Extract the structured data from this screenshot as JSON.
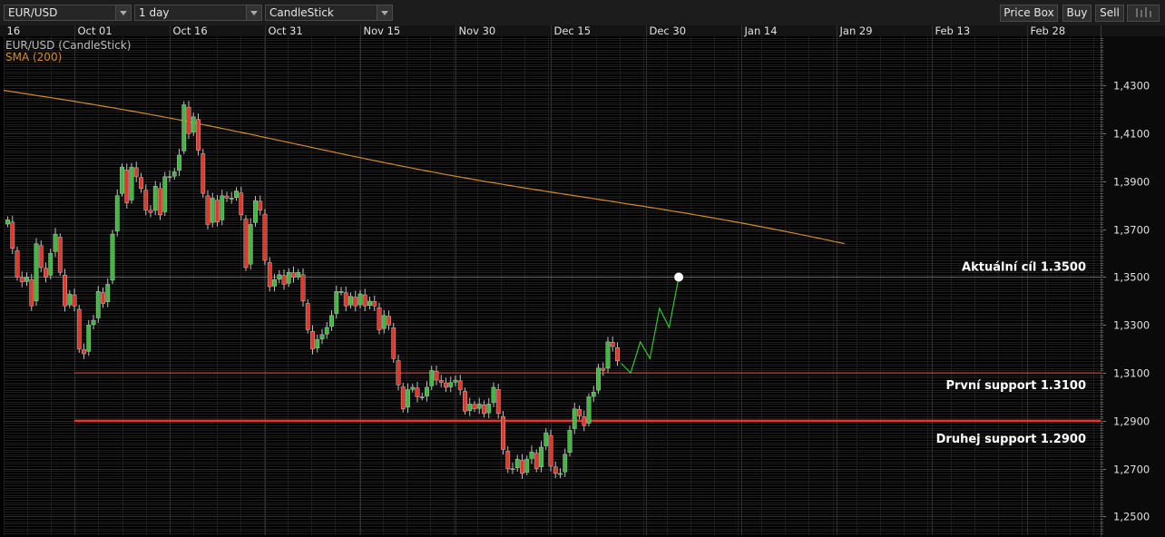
{
  "toolbar": {
    "symbol": "EUR/USD",
    "interval": "1 day",
    "chart_type": "CandleStick",
    "price_box_label": "Price Box",
    "buy_label": "Buy",
    "sell_label": "Sell",
    "settings_icon": "chart-settings-icon"
  },
  "colors": {
    "background": "#000000",
    "grid": "#1e1e1e",
    "bull": "#3fb93f",
    "bear": "#e0392b",
    "sma": "#d48a2a",
    "target_line": "#2f8f2f",
    "support_line": "#e0392b",
    "projection": "#2fc62f"
  },
  "chart_data": {
    "type": "candlestick",
    "legend": [
      "EUR/USD (CandleStick)",
      "SMA (200)"
    ],
    "x_ticks": [
      "16",
      "Oct 01",
      "Oct 16",
      "Oct 31",
      "Nov 15",
      "Nov 30",
      "Dec 15",
      "Dec 30",
      "Jan 14",
      "Jan 29",
      "Feb 13",
      "Feb 28"
    ],
    "y_ticks": [
      "1,4300",
      "1,4100",
      "1,3900",
      "1,3700",
      "1,3500",
      "1,3300",
      "1,3100",
      "1,2900",
      "1,2700",
      "1,2500"
    ],
    "ylim": [
      1.2422,
      1.4506
    ],
    "candles_close": [
      1.374,
      1.362,
      1.35,
      1.348,
      1.35,
      1.338,
      1.364,
      1.354,
      1.35,
      1.36,
      1.368,
      1.352,
      1.338,
      1.343,
      1.338,
      1.32,
      1.318,
      1.33,
      1.332,
      1.344,
      1.339,
      1.347,
      1.368,
      1.384,
      1.396,
      1.381,
      1.396,
      1.392,
      1.387,
      1.378,
      1.377,
      1.388,
      1.376,
      1.392,
      1.392,
      1.394,
      1.401,
      1.422,
      1.41,
      1.417,
      1.403,
      1.385,
      1.372,
      1.383,
      1.373,
      1.384,
      1.383,
      1.383,
      1.386,
      1.376,
      1.354,
      1.372,
      1.382,
      1.378,
      1.357,
      1.346,
      1.349,
      1.351,
      1.347,
      1.352,
      1.35,
      1.352,
      1.34,
      1.328,
      1.32,
      1.324,
      1.326,
      1.329,
      1.334,
      1.344,
      1.344,
      1.338,
      1.342,
      1.338,
      1.343,
      1.338,
      1.34,
      1.338,
      1.328,
      1.334,
      1.33,
      1.316,
      1.305,
      1.295,
      1.303,
      1.304,
      1.3,
      1.3,
      1.304,
      1.311,
      1.307,
      1.306,
      1.304,
      1.306,
      1.307,
      1.303,
      1.294,
      1.297,
      1.295,
      1.297,
      1.293,
      1.297,
      1.304,
      1.293,
      1.278,
      1.27,
      1.27,
      1.274,
      1.268,
      1.274,
      1.277,
      1.27,
      1.279,
      1.285,
      1.271,
      1.268,
      1.268,
      1.276,
      1.286,
      1.295,
      1.292,
      1.288,
      1.3,
      1.302,
      1.312,
      1.311,
      1.323,
      1.321,
      1.315
    ],
    "sma_start": 1.428,
    "sma_end": 1.3635,
    "projection": [
      1.314,
      1.31,
      1.323,
      1.316,
      1.337,
      1.329,
      1.35
    ],
    "annotations": [
      {
        "label": "Aktuální cíl 1.3500",
        "price": 1.35
      },
      {
        "label": "První support 1.3100",
        "price": 1.31
      },
      {
        "label": "Druhej support 1.2900",
        "price": 1.29
      }
    ]
  }
}
